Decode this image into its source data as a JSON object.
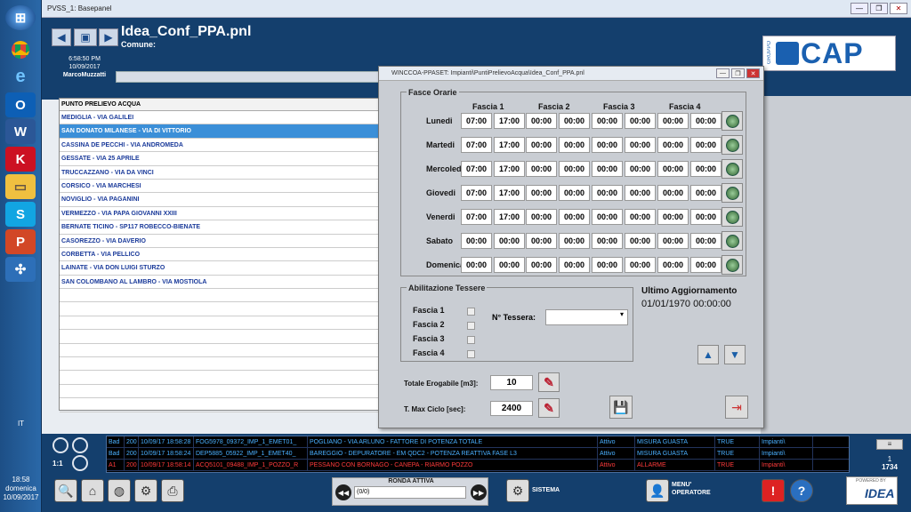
{
  "taskbar": {
    "lang": "IT",
    "time": "18:58",
    "day": "domenica",
    "date": "10/09/2017"
  },
  "window": {
    "title": "PVSS_1: Basepanel"
  },
  "header": {
    "page_title": "Idea_Conf_PPA.pnl",
    "comune_label": "Comune:",
    "time": "6:58:50 PM",
    "date": "10/09/2017",
    "user": "MarcoMuzzatti"
  },
  "logo": {
    "gruppo": "GRUPPO",
    "name": "CAP"
  },
  "list": {
    "header": "PUNTO PRELIEVO ACQUA",
    "rows": [
      "MEDIGLIA - VIA GALILEI",
      "SAN DONATO MILANESE - VIA DI VITTORIO",
      "CASSINA DE PECCHI - VIA ANDROMEDA",
      "GESSATE - VIA 25 APRILE",
      "TRUCCAZZANO - VIA DA VINCI",
      "CORSICO - VIA MARCHESI",
      "NOVIGLIO - VIA PAGANINI",
      "VERMEZZO - VIA PAPA GIOVANNI XXIII",
      "BERNATE TICINO - SP117 ROBECCO-BIENATE",
      "CASOREZZO - VIA DAVERIO",
      "CORBETTA - VIA PELLICO",
      "LAINATE - VIA DON LUIGI STURZO",
      "SAN COLOMBANO AL LAMBRO - VIA MOSTIOLA"
    ]
  },
  "dialog": {
    "title": "WINCCOA-PPASET: Impianti\\PuntiPrelievoAcqua\\Idea_Conf_PPA.pnl",
    "fasce_title": "Fasce Orarie",
    "fasce_headers": [
      "Fascia 1",
      "Fascia 2",
      "Fascia 3",
      "Fascia 4"
    ],
    "days": [
      {
        "name": "Lunedi",
        "times": [
          "07:00",
          "17:00",
          "00:00",
          "00:00",
          "00:00",
          "00:00",
          "00:00",
          "00:00"
        ]
      },
      {
        "name": "Martedi",
        "times": [
          "07:00",
          "17:00",
          "00:00",
          "00:00",
          "00:00",
          "00:00",
          "00:00",
          "00:00"
        ]
      },
      {
        "name": "Mercoledi",
        "times": [
          "07:00",
          "17:00",
          "00:00",
          "00:00",
          "00:00",
          "00:00",
          "00:00",
          "00:00"
        ]
      },
      {
        "name": "Giovedi",
        "times": [
          "07:00",
          "17:00",
          "00:00",
          "00:00",
          "00:00",
          "00:00",
          "00:00",
          "00:00"
        ]
      },
      {
        "name": "Venerdi",
        "times": [
          "07:00",
          "17:00",
          "00:00",
          "00:00",
          "00:00",
          "00:00",
          "00:00",
          "00:00"
        ]
      },
      {
        "name": "Sabato",
        "times": [
          "00:00",
          "00:00",
          "00:00",
          "00:00",
          "00:00",
          "00:00",
          "00:00",
          "00:00"
        ]
      },
      {
        "name": "Domenica",
        "times": [
          "00:00",
          "00:00",
          "00:00",
          "00:00",
          "00:00",
          "00:00",
          "00:00",
          "00:00"
        ]
      }
    ],
    "tessere_title": "Abilitazione Tessere",
    "tessere_fasce": [
      "Fascia 1",
      "Fascia 2",
      "Fascia 3",
      "Fascia 4"
    ],
    "n_tessera_label": "N° Tessera:",
    "ultimo_title": "Ultimo Aggiornamento",
    "ultimo_value": "01/01/1970 00:00:00",
    "totale_label": "Totale Erogabile [m3]:",
    "totale_value": "10",
    "tmax_label": "T. Max Ciclo [sec]:",
    "tmax_value": "2400"
  },
  "alarms": {
    "rows": [
      {
        "code": "Bad",
        "n": "200",
        "date": "10/09/17 18:58:28",
        "id": "FOG5978_09372_IMP_1_EMET01_",
        "desc": "POGLIANO - VIA ARLUNO - FATTORE DI POTENZA TOTALE",
        "state": "Attivo",
        "type": "MISURA GUASTA",
        "val": "TRUE",
        "src": "Impianti\\",
        "color": "#4ab0ff"
      },
      {
        "code": "Bad",
        "n": "200",
        "date": "10/09/17 18:58:24",
        "id": "DEP5885_05922_IMP_1_EMET40_",
        "desc": "BAREGGIO - DEPURATORE - EM QDC2 - POTENZA REATTIVA FASE L3",
        "state": "Attivo",
        "type": "MISURA GUASTA",
        "val": "TRUE",
        "src": "Impianti\\",
        "color": "#4ab0ff"
      },
      {
        "code": "A1",
        "n": "200",
        "date": "10/09/17 18:58:14",
        "id": "ACQ5101_09488_IMP_1_POZZO_R",
        "desc": "PESSANO CON BORNAGO - CANEPA - RIARMO POZZO",
        "state": "Attivo",
        "type": "ALLARME",
        "val": "TRUE",
        "src": "Impianti\\",
        "color": "#ff3b3b"
      }
    ],
    "count": "1",
    "total": "1734"
  },
  "footer": {
    "ronda_title": "RONDA ATTIVA",
    "ronda_value": "(0/0)",
    "sistema": "SISTEMA",
    "menu_1": "MENU'",
    "menu_2": "OPERATORE",
    "powered": "POWERED BY",
    "idea": "IDEA"
  }
}
